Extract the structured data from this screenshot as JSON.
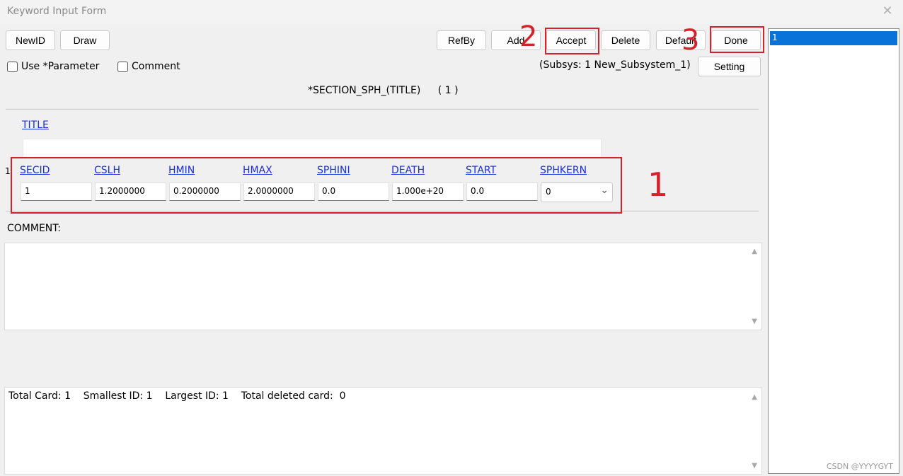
{
  "window": {
    "title": "Keyword Input Form"
  },
  "toolbar": {
    "newid": "NewID",
    "draw": "Draw",
    "refby": "RefBy",
    "add": "Add",
    "accept": "Accept",
    "delete": "Delete",
    "default": "Default",
    "done": "Done",
    "setting": "Setting"
  },
  "options": {
    "use_parameter": "Use *Parameter",
    "comment": "Comment",
    "subsys": "(Subsys: 1 New_Subsystem_1)"
  },
  "card": {
    "keyword": "*SECTION_SPH_(TITLE)",
    "count": "( 1 )",
    "title_label": "TITLE",
    "title_value": "",
    "row_number": "1",
    "fields": [
      {
        "label": "SECID",
        "value": "1"
      },
      {
        "label": "CSLH",
        "value": "1.2000000"
      },
      {
        "label": "HMIN",
        "value": "0.2000000"
      },
      {
        "label": "HMAX",
        "value": "2.0000000"
      },
      {
        "label": "SPHINI",
        "value": "0.0"
      },
      {
        "label": "DEATH",
        "value": "1.000e+20"
      },
      {
        "label": "START",
        "value": "0.0"
      },
      {
        "label": "SPHKERN",
        "value": "0"
      }
    ]
  },
  "comment_section": {
    "label": "COMMENT:"
  },
  "footer": {
    "total_card": "Total Card: 1",
    "smallest_id": "Smallest ID: 1",
    "largest_id": "Largest ID: 1",
    "total_deleted": "Total deleted card:  0"
  },
  "id_list": {
    "items": [
      "1"
    ]
  },
  "annotations": {
    "step1": "1",
    "step2": "2",
    "step3": "3"
  },
  "watermark": "CSDN @YYYYGYT",
  "colors": {
    "annotation_red": "#d6202a",
    "link_blue": "#1a2ee0",
    "selection_blue": "#0a73d9"
  }
}
